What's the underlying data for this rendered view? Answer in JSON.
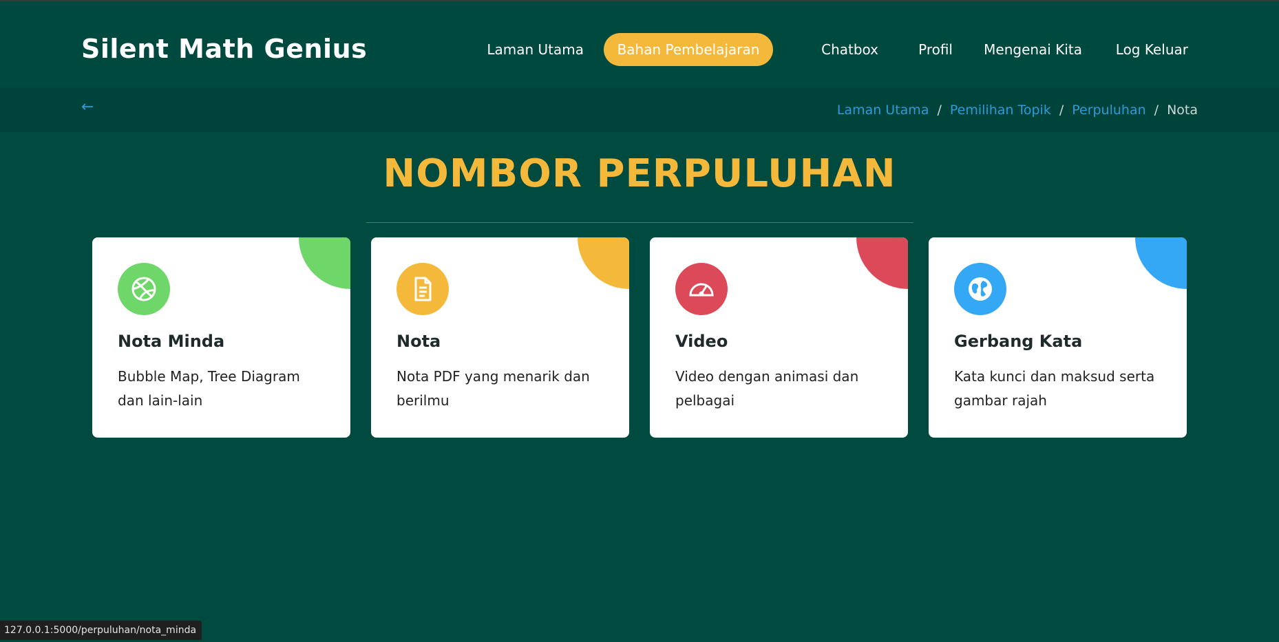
{
  "app": {
    "logo": "Silent Math Genius"
  },
  "nav": {
    "items": [
      {
        "label": "Laman Utama",
        "active": false
      },
      {
        "label": "Bahan Pembelajaran",
        "active": true
      },
      {
        "label": "Chatbox",
        "active": false
      },
      {
        "label": "Profil",
        "active": false
      },
      {
        "label": "Mengenai Kita",
        "active": false
      },
      {
        "label": "Log Keluar",
        "active": false
      }
    ]
  },
  "breadcrumb": {
    "back_icon": "←",
    "items": [
      "Laman Utama",
      "Pemilihan Topik",
      "Perpuluhan"
    ],
    "separator": "/",
    "current": "Nota"
  },
  "page": {
    "title": "NOMBOR PERPULUHAN"
  },
  "cards": [
    {
      "title": "Nota Minda",
      "description": "Bubble Map, Tree Diagram dan lain-lain",
      "icon": "basketball-icon",
      "color": "#6fd66a"
    },
    {
      "title": "Nota",
      "description": "Nota PDF yang menarik dan berilmu",
      "icon": "file-text-icon",
      "color": "#f4b83b"
    },
    {
      "title": "Video",
      "description": "Video dengan animasi dan pelbagai",
      "icon": "speedometer-icon",
      "color": "#dc4a5a"
    },
    {
      "title": "Gerbang Kata",
      "description": "Kata kunci dan maksud serta gambar rajah",
      "icon": "globe-icon",
      "color": "#35a8f5"
    }
  ],
  "status": {
    "url": "127.0.0.1:5000/perpuluhan/nota_minda"
  },
  "colors": {
    "background": "#004a40",
    "accent": "#f4b83b",
    "link": "#2e9bd6"
  }
}
